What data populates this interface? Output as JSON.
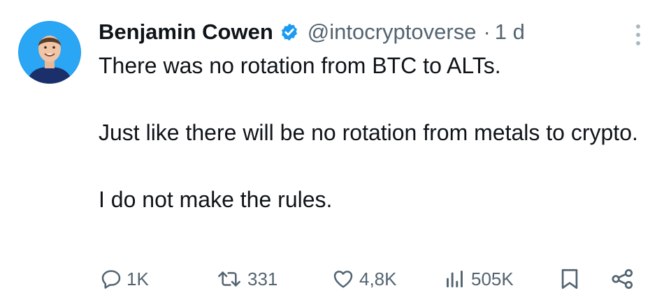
{
  "author": {
    "name": "Benjamin Cowen",
    "handle": "@intocryptoverse",
    "separator": "·",
    "time": "1 d"
  },
  "tweet": {
    "lines": [
      "There was no rotation from BTC to ALTs.",
      "Just like there will be no rotation from metals to crypto.",
      "I do not make the rules."
    ]
  },
  "actions": {
    "replies": "1K",
    "reposts": "331",
    "likes": "4,8K",
    "views": "505K"
  },
  "icons": {
    "verified": "verified-badge-icon",
    "more": "more-vertical-icon",
    "reply": "reply-icon",
    "repost": "repost-icon",
    "like": "heart-icon",
    "views": "views-bar-icon",
    "bookmark": "bookmark-icon",
    "share": "share-icon"
  },
  "colors": {
    "text": "#0f1419",
    "secondary": "#536471",
    "verified": "#1d9bf0",
    "avatar_bg": "#1d9bf0"
  }
}
